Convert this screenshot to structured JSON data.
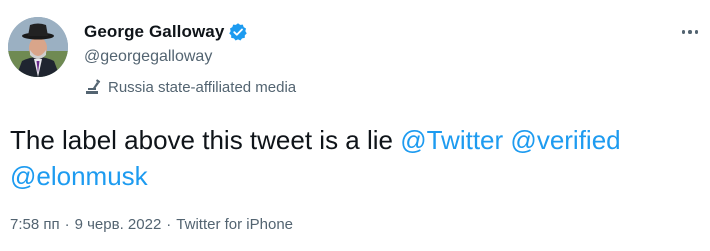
{
  "user": {
    "display_name": "George Galloway",
    "handle": "@georgegalloway",
    "verified_icon": "verified-badge-icon",
    "label": "Russia state-affiliated media",
    "label_icon": "state-media-icon"
  },
  "tweet": {
    "text_plain": "The label above this tweet is a lie ",
    "mentions": [
      "@Twitter",
      "@verified",
      "@elonmusk"
    ]
  },
  "meta": {
    "time": "7:58 пп",
    "separator": "·",
    "date": "9 черв. 2022",
    "source": "Twitter for iPhone"
  },
  "colors": {
    "accent": "#1d9bf0",
    "text": "#0f1419",
    "muted": "#536471"
  },
  "icons": {
    "more": "more-options-icon"
  }
}
